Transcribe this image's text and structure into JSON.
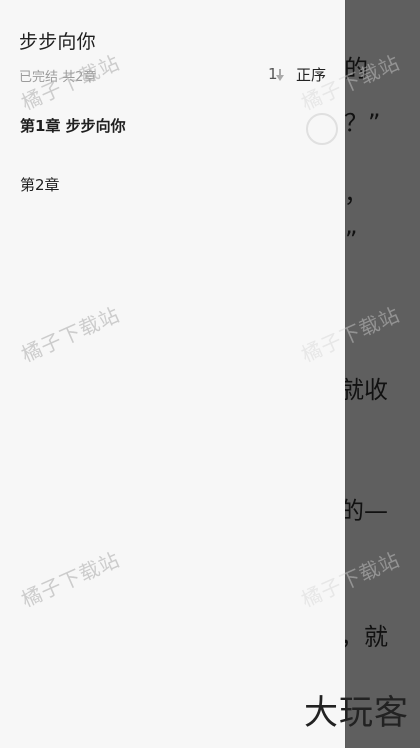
{
  "app": {
    "book_title": "步步向你",
    "status": "已完结 共2章",
    "sort_label": "正序"
  },
  "chapters": [
    {
      "label": "第1章 步步向你"
    },
    {
      "label": "第2章"
    }
  ],
  "reader_background_text": [
    "星的",
    "己？”",
    "的，",
    "”",
    "就收",
    "的—",
    "，就"
  ],
  "watermark": "橘子下载站",
  "bottom_logo": "大玩客"
}
